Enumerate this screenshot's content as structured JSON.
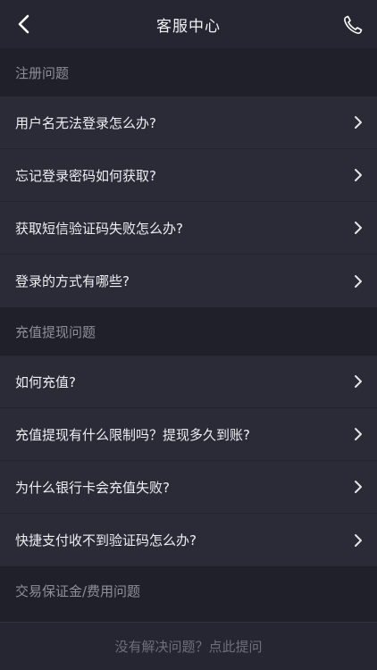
{
  "header": {
    "title": "客服中心"
  },
  "sections": [
    {
      "title": "注册问题",
      "items": [
        "用户名无法登录怎么办?",
        "忘记登录密码如何获取?",
        "获取短信验证码失败怎么办?",
        "登录的方式有哪些?"
      ]
    },
    {
      "title": "充值提现问题",
      "items": [
        "如何充值?",
        "充值提现有什么限制吗？提现多久到账?",
        "为什么银行卡会充值失败?",
        "快捷支付收不到验证码怎么办?"
      ]
    },
    {
      "title": "交易保证金/费用问题",
      "items": []
    }
  ],
  "footer": {
    "ask_label": "没有解决问题？点此提问"
  },
  "colors": {
    "background": "#1f202a",
    "row": "#2a2b36",
    "header": "#252631",
    "section_text": "#8e8f99",
    "footer_text": "#6e6f7a"
  }
}
